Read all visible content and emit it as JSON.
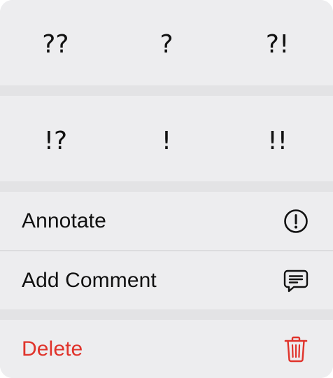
{
  "annotation_glyphs": {
    "row1": [
      "??",
      "?",
      "?!"
    ],
    "row2": [
      "!?",
      "!",
      "!!"
    ]
  },
  "actions": [
    {
      "label": "Annotate",
      "icon": "exclamation-circle-icon"
    },
    {
      "label": "Add Comment",
      "icon": "comment-bubble-icon"
    }
  ],
  "destructive_action": {
    "label": "Delete",
    "icon": "trash-icon"
  },
  "colors": {
    "destructive": "#e0332b",
    "text": "#111111",
    "menu_background": "#ededef",
    "group_gap": "#e3e3e5"
  }
}
